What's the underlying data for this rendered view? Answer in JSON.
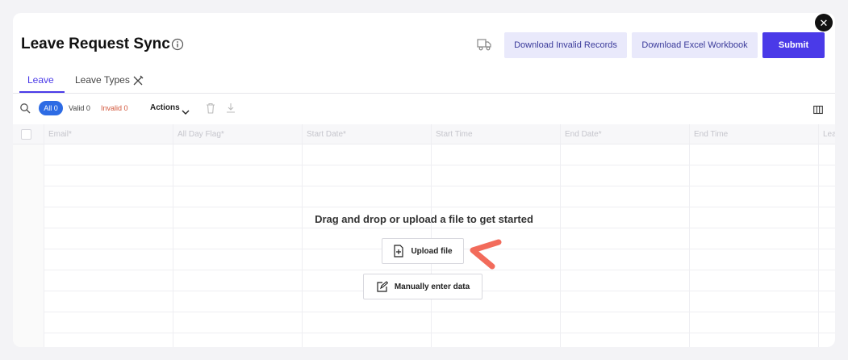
{
  "header": {
    "title": "Leave Request Sync",
    "buttons": {
      "download_invalid": "Download Invalid Records",
      "download_excel": "Download Excel Workbook",
      "submit": "Submit"
    }
  },
  "tabs": [
    {
      "label": "Leave",
      "active": true
    },
    {
      "label": "Leave Types",
      "active": false
    }
  ],
  "toolbar": {
    "all": "All 0",
    "valid": "Valid 0",
    "invalid": "Invalid 0",
    "actions": "Actions"
  },
  "grid": {
    "columns": [
      "Email*",
      "All Day Flag*",
      "Start Date*",
      "Start Time",
      "End Date*",
      "End Time",
      "Lea"
    ]
  },
  "empty_state": {
    "title": "Drag and drop or upload a file to get started",
    "upload_label": "Upload file",
    "manual_label": "Manually enter data"
  },
  "colors": {
    "accent": "#4a3ae8",
    "pill": "#2d6be4",
    "invalid": "#d2553a",
    "arrow": "#f26b5b"
  },
  "icons": [
    "close-icon",
    "info-icon",
    "truck-icon",
    "tools-icon",
    "search-icon",
    "chevron-down-icon",
    "trash-icon",
    "download-icon",
    "columns-icon",
    "file-plus-icon",
    "edit-icon",
    "arrow-pointer-icon"
  ]
}
